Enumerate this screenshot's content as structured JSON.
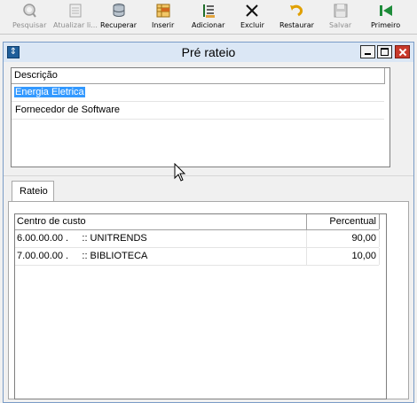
{
  "toolbar": {
    "buttons": [
      {
        "label": "Pesquisar",
        "icon": "magnifier-icon",
        "enabled": false
      },
      {
        "label": "Atualizar li...",
        "icon": "refresh-list-icon",
        "enabled": false
      },
      {
        "label": "Recuperar",
        "icon": "database-icon",
        "enabled": true
      },
      {
        "label": "Inserir",
        "icon": "insert-icon",
        "enabled": true
      },
      {
        "label": "Adicionar",
        "icon": "add-icon",
        "enabled": true
      },
      {
        "label": "Excluir",
        "icon": "x-delete-icon",
        "enabled": true
      },
      {
        "label": "Restaurar",
        "icon": "undo-icon",
        "enabled": true
      },
      {
        "label": "Salvar",
        "icon": "floppy-disk-icon",
        "enabled": false
      },
      {
        "label": "Primeiro",
        "icon": "first-record-icon",
        "enabled": true
      }
    ]
  },
  "window": {
    "title": "Pré rateio",
    "colors": {
      "title_bg": "#dbe7f5",
      "close": "#c8392b",
      "selection": "#3399ff"
    }
  },
  "top_grid": {
    "header": "Descrição",
    "rows": [
      {
        "text": "Energia Eletrica",
        "selected": true
      },
      {
        "text": "Fornecedor de Software",
        "selected": false
      }
    ]
  },
  "tab": {
    "label": "Rateio"
  },
  "bottom_grid": {
    "headers": [
      "Centro de custo",
      "Percentual"
    ],
    "rows": [
      {
        "centro": "6.00.00.00 .     :: UNITRENDS",
        "percentual": "90,00"
      },
      {
        "centro": "7.00.00.00 .     :: BIBLIOTECA",
        "percentual": "10,00"
      }
    ]
  }
}
